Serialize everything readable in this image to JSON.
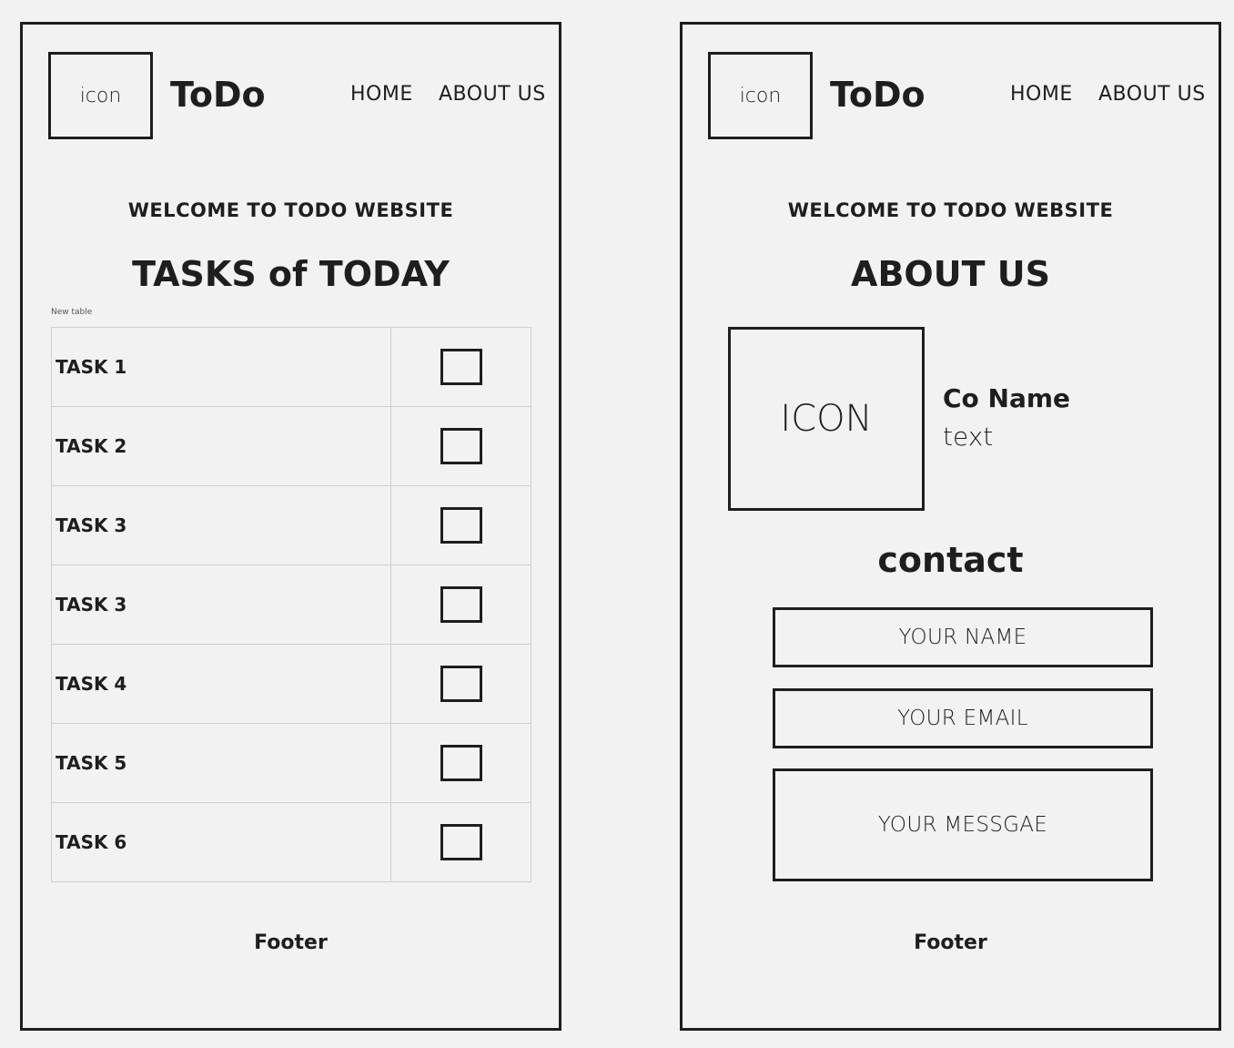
{
  "home_screen": {
    "logo_label": "icon",
    "brand": "ToDo",
    "nav": {
      "home": "HOME",
      "about": "ABOUT US",
      "active": "home"
    },
    "welcome": "WELCOME TO TODO WEBSITE",
    "heading": "TASKS of TODAY",
    "table_caption": "New table",
    "tasks": [
      {
        "label": "TASK 1",
        "checked": false
      },
      {
        "label": "TASK 2",
        "checked": false
      },
      {
        "label": "TASK 3",
        "checked": false
      },
      {
        "label": "TASK 3",
        "checked": false
      },
      {
        "label": "TASK 4",
        "checked": false
      },
      {
        "label": "TASK 5",
        "checked": false
      },
      {
        "label": "TASK 6",
        "checked": false
      }
    ],
    "footer": "Footer"
  },
  "about_screen": {
    "logo_label": "icon",
    "brand": "ToDo",
    "nav": {
      "home": "HOME",
      "about": "ABOUT US",
      "active": "about"
    },
    "welcome": "WELCOME TO TODO WEBSITE",
    "heading": "ABOUT US",
    "company_icon_label": "ICON",
    "company_name": "Co Name",
    "company_text": "text",
    "contact_heading": "contact",
    "contact_form": {
      "name_placeholder": "YOUR NAME",
      "email_placeholder": "YOUR EMAIL",
      "message_placeholder": "YOUR MESSGAE"
    },
    "footer": "Footer"
  },
  "colors": {
    "background": "#f2f2f2",
    "ink": "#1e1e1e",
    "table_border": "#cfcfcf"
  }
}
